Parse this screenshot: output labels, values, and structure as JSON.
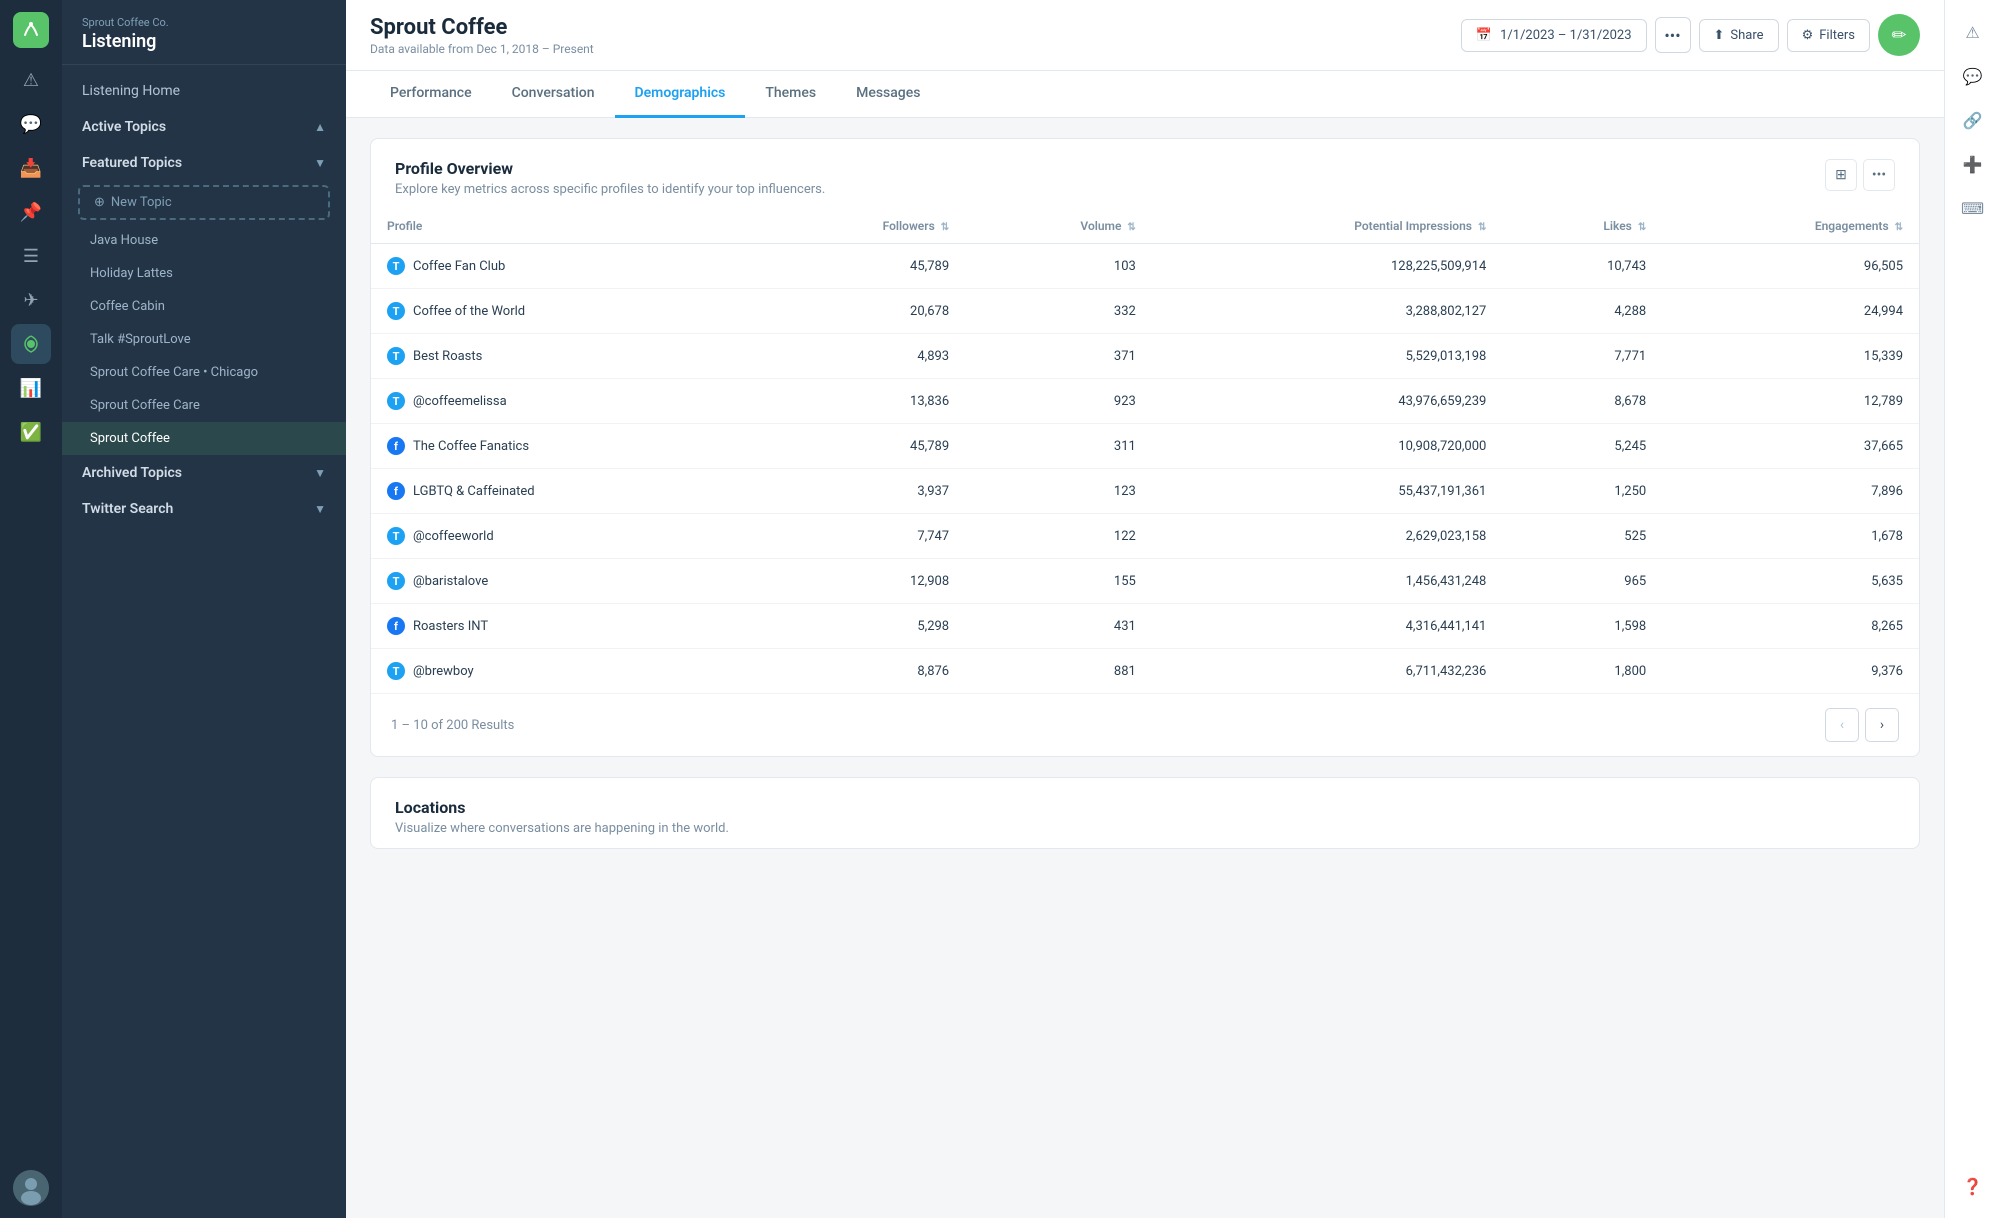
{
  "app": {
    "brand": "Sprout Coffee Co.",
    "module": "Listening"
  },
  "header": {
    "title": "Sprout Coffee",
    "subtitle": "Data available from Dec 1, 2018 – Present",
    "date_range": "1/1/2023 – 1/31/2023",
    "share_label": "Share",
    "filters_label": "Filters"
  },
  "tabs": [
    {
      "id": "performance",
      "label": "Performance",
      "active": false
    },
    {
      "id": "conversation",
      "label": "Conversation",
      "active": false
    },
    {
      "id": "demographics",
      "label": "Demographics",
      "active": true
    },
    {
      "id": "themes",
      "label": "Themes",
      "active": false
    },
    {
      "id": "messages",
      "label": "Messages",
      "active": false
    }
  ],
  "sidebar": {
    "nav_item": "Listening Home",
    "active_topics_label": "Active Topics",
    "featured_topics_label": "Featured Topics",
    "new_topic_label": "New Topic",
    "topics": [
      {
        "id": "java-house",
        "label": "Java House"
      },
      {
        "id": "holiday-lattes",
        "label": "Holiday Lattes"
      },
      {
        "id": "coffee-cabin",
        "label": "Coffee Cabin"
      },
      {
        "id": "talk-sproutlove",
        "label": "Talk #SproutLove"
      },
      {
        "id": "sprout-coffee-care-chicago",
        "label": "Sprout Coffee Care • Chicago"
      },
      {
        "id": "sprout-coffee-care",
        "label": "Sprout Coffee Care"
      },
      {
        "id": "sprout-coffee",
        "label": "Sprout Coffee",
        "active": true
      }
    ],
    "archived_topics_label": "Archived Topics",
    "twitter_search_label": "Twitter Search"
  },
  "profile_overview": {
    "title": "Profile Overview",
    "subtitle": "Explore key metrics across specific profiles to identify your top influencers.",
    "columns": [
      "Profile",
      "Followers",
      "Volume",
      "Potential Impressions",
      "Likes",
      "Engagements"
    ],
    "rows": [
      {
        "name": "Coffee Fan Club",
        "platform": "twitter",
        "followers": "45,789",
        "volume": "103",
        "impressions": "128,225,509,914",
        "likes": "10,743",
        "engagements": "96,505"
      },
      {
        "name": "Coffee of the World",
        "platform": "twitter",
        "followers": "20,678",
        "volume": "332",
        "impressions": "3,288,802,127",
        "likes": "4,288",
        "engagements": "24,994"
      },
      {
        "name": "Best Roasts",
        "platform": "twitter",
        "followers": "4,893",
        "volume": "371",
        "impressions": "5,529,013,198",
        "likes": "7,771",
        "engagements": "15,339"
      },
      {
        "name": "@coffeemelissa",
        "platform": "twitter",
        "followers": "13,836",
        "volume": "923",
        "impressions": "43,976,659,239",
        "likes": "8,678",
        "engagements": "12,789"
      },
      {
        "name": "The Coffee Fanatics",
        "platform": "facebook",
        "followers": "45,789",
        "volume": "311",
        "impressions": "10,908,720,000",
        "likes": "5,245",
        "engagements": "37,665"
      },
      {
        "name": "LGBTQ & Caffeinated",
        "platform": "facebook",
        "followers": "3,937",
        "volume": "123",
        "impressions": "55,437,191,361",
        "likes": "1,250",
        "engagements": "7,896"
      },
      {
        "name": "@coffeeworld",
        "platform": "twitter",
        "followers": "7,747",
        "volume": "122",
        "impressions": "2,629,023,158",
        "likes": "525",
        "engagements": "1,678"
      },
      {
        "name": "@baristalove",
        "platform": "twitter",
        "followers": "12,908",
        "volume": "155",
        "impressions": "1,456,431,248",
        "likes": "965",
        "engagements": "5,635"
      },
      {
        "name": "Roasters INT",
        "platform": "facebook",
        "followers": "5,298",
        "volume": "431",
        "impressions": "4,316,441,141",
        "likes": "1,598",
        "engagements": "8,265"
      },
      {
        "name": "@brewboy",
        "platform": "twitter",
        "followers": "8,876",
        "volume": "881",
        "impressions": "6,711,432,236",
        "likes": "1,800",
        "engagements": "9,376"
      }
    ],
    "pagination": {
      "text": "1 – 10 of 200 Results",
      "prev_label": "‹",
      "next_label": "›"
    }
  },
  "locations": {
    "title": "Locations",
    "subtitle": "Visualize where conversations are happening in the world."
  },
  "colors": {
    "twitter": "#1da1f2",
    "facebook": "#1877f2",
    "active_tab": "#1da1f2",
    "green": "#59c36a"
  }
}
